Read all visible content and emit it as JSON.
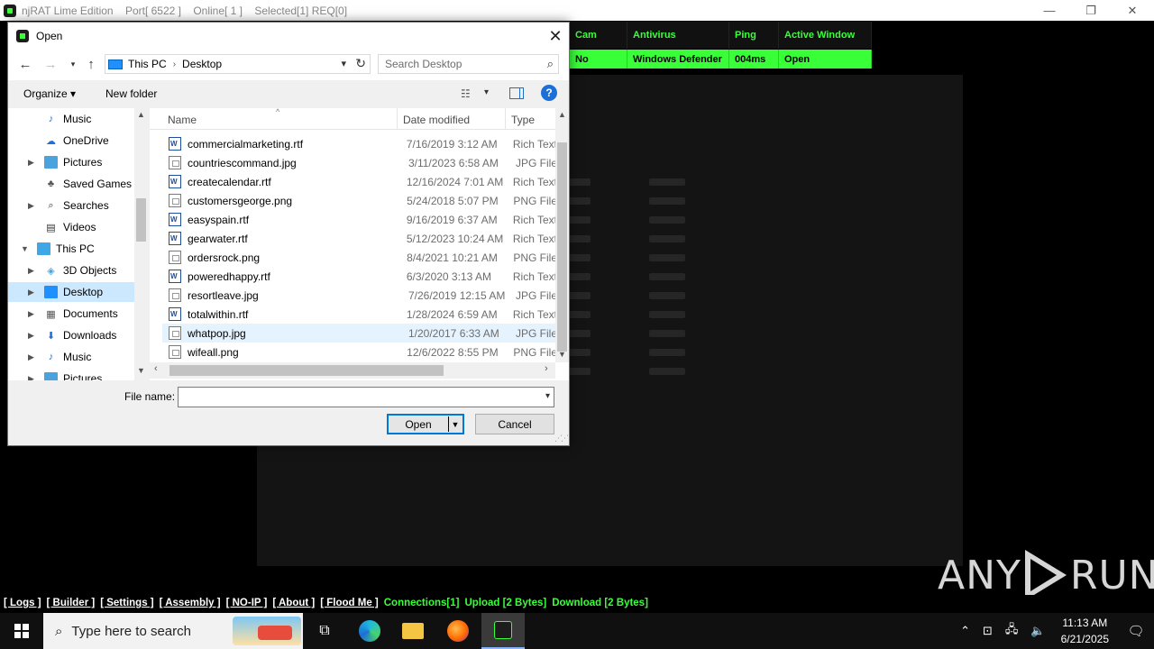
{
  "rat": {
    "title": "njRAT Lime Edition    Port[ 6522 ]    Online[ 1 ]    Selected[1] REQ[0]",
    "columns": [
      "Cam",
      "Antivirus",
      "Ping",
      "Active Window"
    ],
    "row": [
      "No",
      "Windows Defender",
      "004ms",
      "Open"
    ],
    "footer_links": [
      "[ Logs ]",
      "[ Builder ]",
      "[ Settings ]",
      "[ Assembly ]",
      "[ NO-IP ]",
      "[ About ]",
      "[ Flood Me ]"
    ],
    "footer_status": [
      "Connections[1]",
      "Upload [2 Bytes]",
      "Download [2 Bytes]"
    ],
    "accent_color": "#39ff39"
  },
  "dialog": {
    "title": "Open",
    "address": [
      "This PC",
      "Desktop"
    ],
    "search_placeholder": "Search Desktop",
    "toolbar": {
      "organize": "Organize ▾",
      "new_folder": "New folder"
    },
    "tree": [
      {
        "label": "Music",
        "icon": "music-icon",
        "expand": false
      },
      {
        "label": "OneDrive",
        "icon": "cloud-icon",
        "expand": false
      },
      {
        "label": "Pictures",
        "icon": "pictures-icon",
        "expand": true
      },
      {
        "label": "Saved Games",
        "icon": "saved-games-icon",
        "expand": false
      },
      {
        "label": "Searches",
        "icon": "search-icon",
        "expand": true
      },
      {
        "label": "Videos",
        "icon": "video-icon",
        "expand": false
      },
      {
        "label": "This PC",
        "icon": "computer-icon",
        "expand": "open"
      },
      {
        "label": "3D Objects",
        "icon": "3d-objects-icon",
        "expand": true
      },
      {
        "label": "Desktop",
        "icon": "desktop-icon",
        "expand": true,
        "selected": true
      },
      {
        "label": "Documents",
        "icon": "documents-icon",
        "expand": true
      },
      {
        "label": "Downloads",
        "icon": "downloads-icon",
        "expand": true
      },
      {
        "label": "Music",
        "icon": "music-icon",
        "expand": true
      },
      {
        "label": "Pictures",
        "icon": "pictures-icon",
        "expand": true
      }
    ],
    "columns": {
      "name": "Name",
      "date": "Date modified",
      "type": "Type"
    },
    "files": [
      {
        "name": "commercialmarketing.rtf",
        "date": "7/16/2019 3:12 AM",
        "type": "Rich Text",
        "kind": "rtf"
      },
      {
        "name": "countriescommand.jpg",
        "date": "3/11/2023 6:58 AM",
        "type": "JPG File",
        "kind": "img"
      },
      {
        "name": "createcalendar.rtf",
        "date": "12/16/2024 7:01 AM",
        "type": "Rich Text",
        "kind": "rtf"
      },
      {
        "name": "customersgeorge.png",
        "date": "5/24/2018 5:07 PM",
        "type": "PNG File",
        "kind": "img"
      },
      {
        "name": "easyspain.rtf",
        "date": "9/16/2019 6:37 AM",
        "type": "Rich Text",
        "kind": "rtf"
      },
      {
        "name": "gearwater.rtf",
        "date": "5/12/2023 10:24 AM",
        "type": "Rich Text",
        "kind": "rtf"
      },
      {
        "name": "ordersrock.png",
        "date": "8/4/2021 10:21 AM",
        "type": "PNG File",
        "kind": "img"
      },
      {
        "name": "poweredhappy.rtf",
        "date": "6/3/2020 3:13 AM",
        "type": "Rich Text",
        "kind": "rtf"
      },
      {
        "name": "resortleave.jpg",
        "date": "7/26/2019 12:15 AM",
        "type": "JPG File",
        "kind": "img"
      },
      {
        "name": "totalwithin.rtf",
        "date": "1/28/2024 6:59 AM",
        "type": "Rich Text",
        "kind": "rtf"
      },
      {
        "name": "whatpop.jpg",
        "date": "1/20/2017 6:33 AM",
        "type": "JPG File",
        "kind": "img",
        "hover": true
      },
      {
        "name": "wifeall.png",
        "date": "12/6/2022 8:55 PM",
        "type": "PNG File",
        "kind": "img"
      }
    ],
    "file_name_label": "File name:",
    "file_name_value": "",
    "open_label": "Open",
    "cancel_label": "Cancel"
  },
  "taskbar": {
    "search_placeholder": "Type here to search",
    "time": "11:13 AM",
    "date": "6/21/2025"
  },
  "watermark": {
    "left": "ANY",
    "right": "RUN"
  }
}
